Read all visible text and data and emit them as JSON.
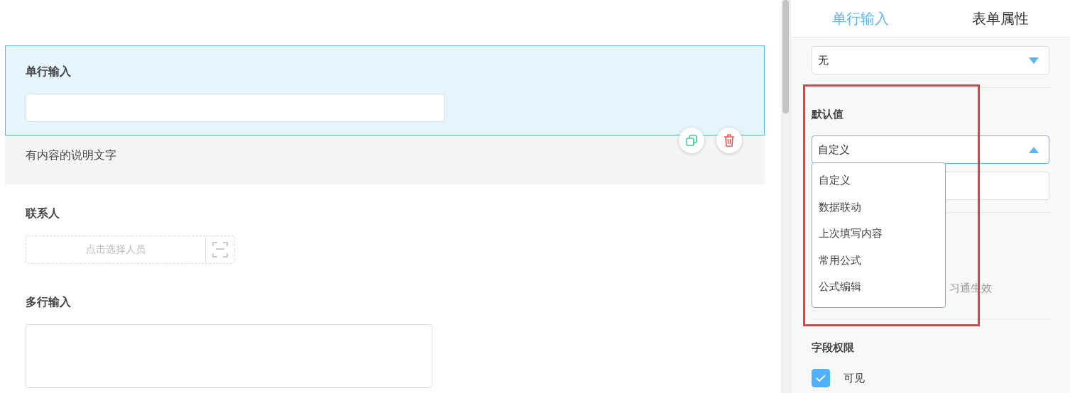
{
  "canvas": {
    "fields": [
      {
        "kind": "text",
        "label": "单行输入",
        "selected": true,
        "description": "有内容的说明文字"
      },
      {
        "kind": "person",
        "label": "联系人",
        "placeholder": "点击选择人员",
        "selected": false
      },
      {
        "kind": "textarea",
        "label": "多行输入",
        "selected": false
      }
    ]
  },
  "panel": {
    "tabs": [
      {
        "label": "单行输入",
        "selected": true
      },
      {
        "label": "表单属性",
        "selected": false
      }
    ],
    "top_select": {
      "value": "无",
      "expanded": false
    },
    "default_value": {
      "label": "默认值",
      "select": {
        "value": "自定义",
        "expanded": true
      },
      "options": [
        {
          "label": "自定义"
        },
        {
          "label": "数据联动"
        },
        {
          "label": "上次填写内容"
        },
        {
          "label": "常用公式"
        },
        {
          "label": "公式编辑"
        }
      ]
    },
    "hidden_note": "习通生效",
    "permissions": {
      "label": "字段权限",
      "items": [
        {
          "label": "可见",
          "checked": true
        }
      ]
    }
  }
}
